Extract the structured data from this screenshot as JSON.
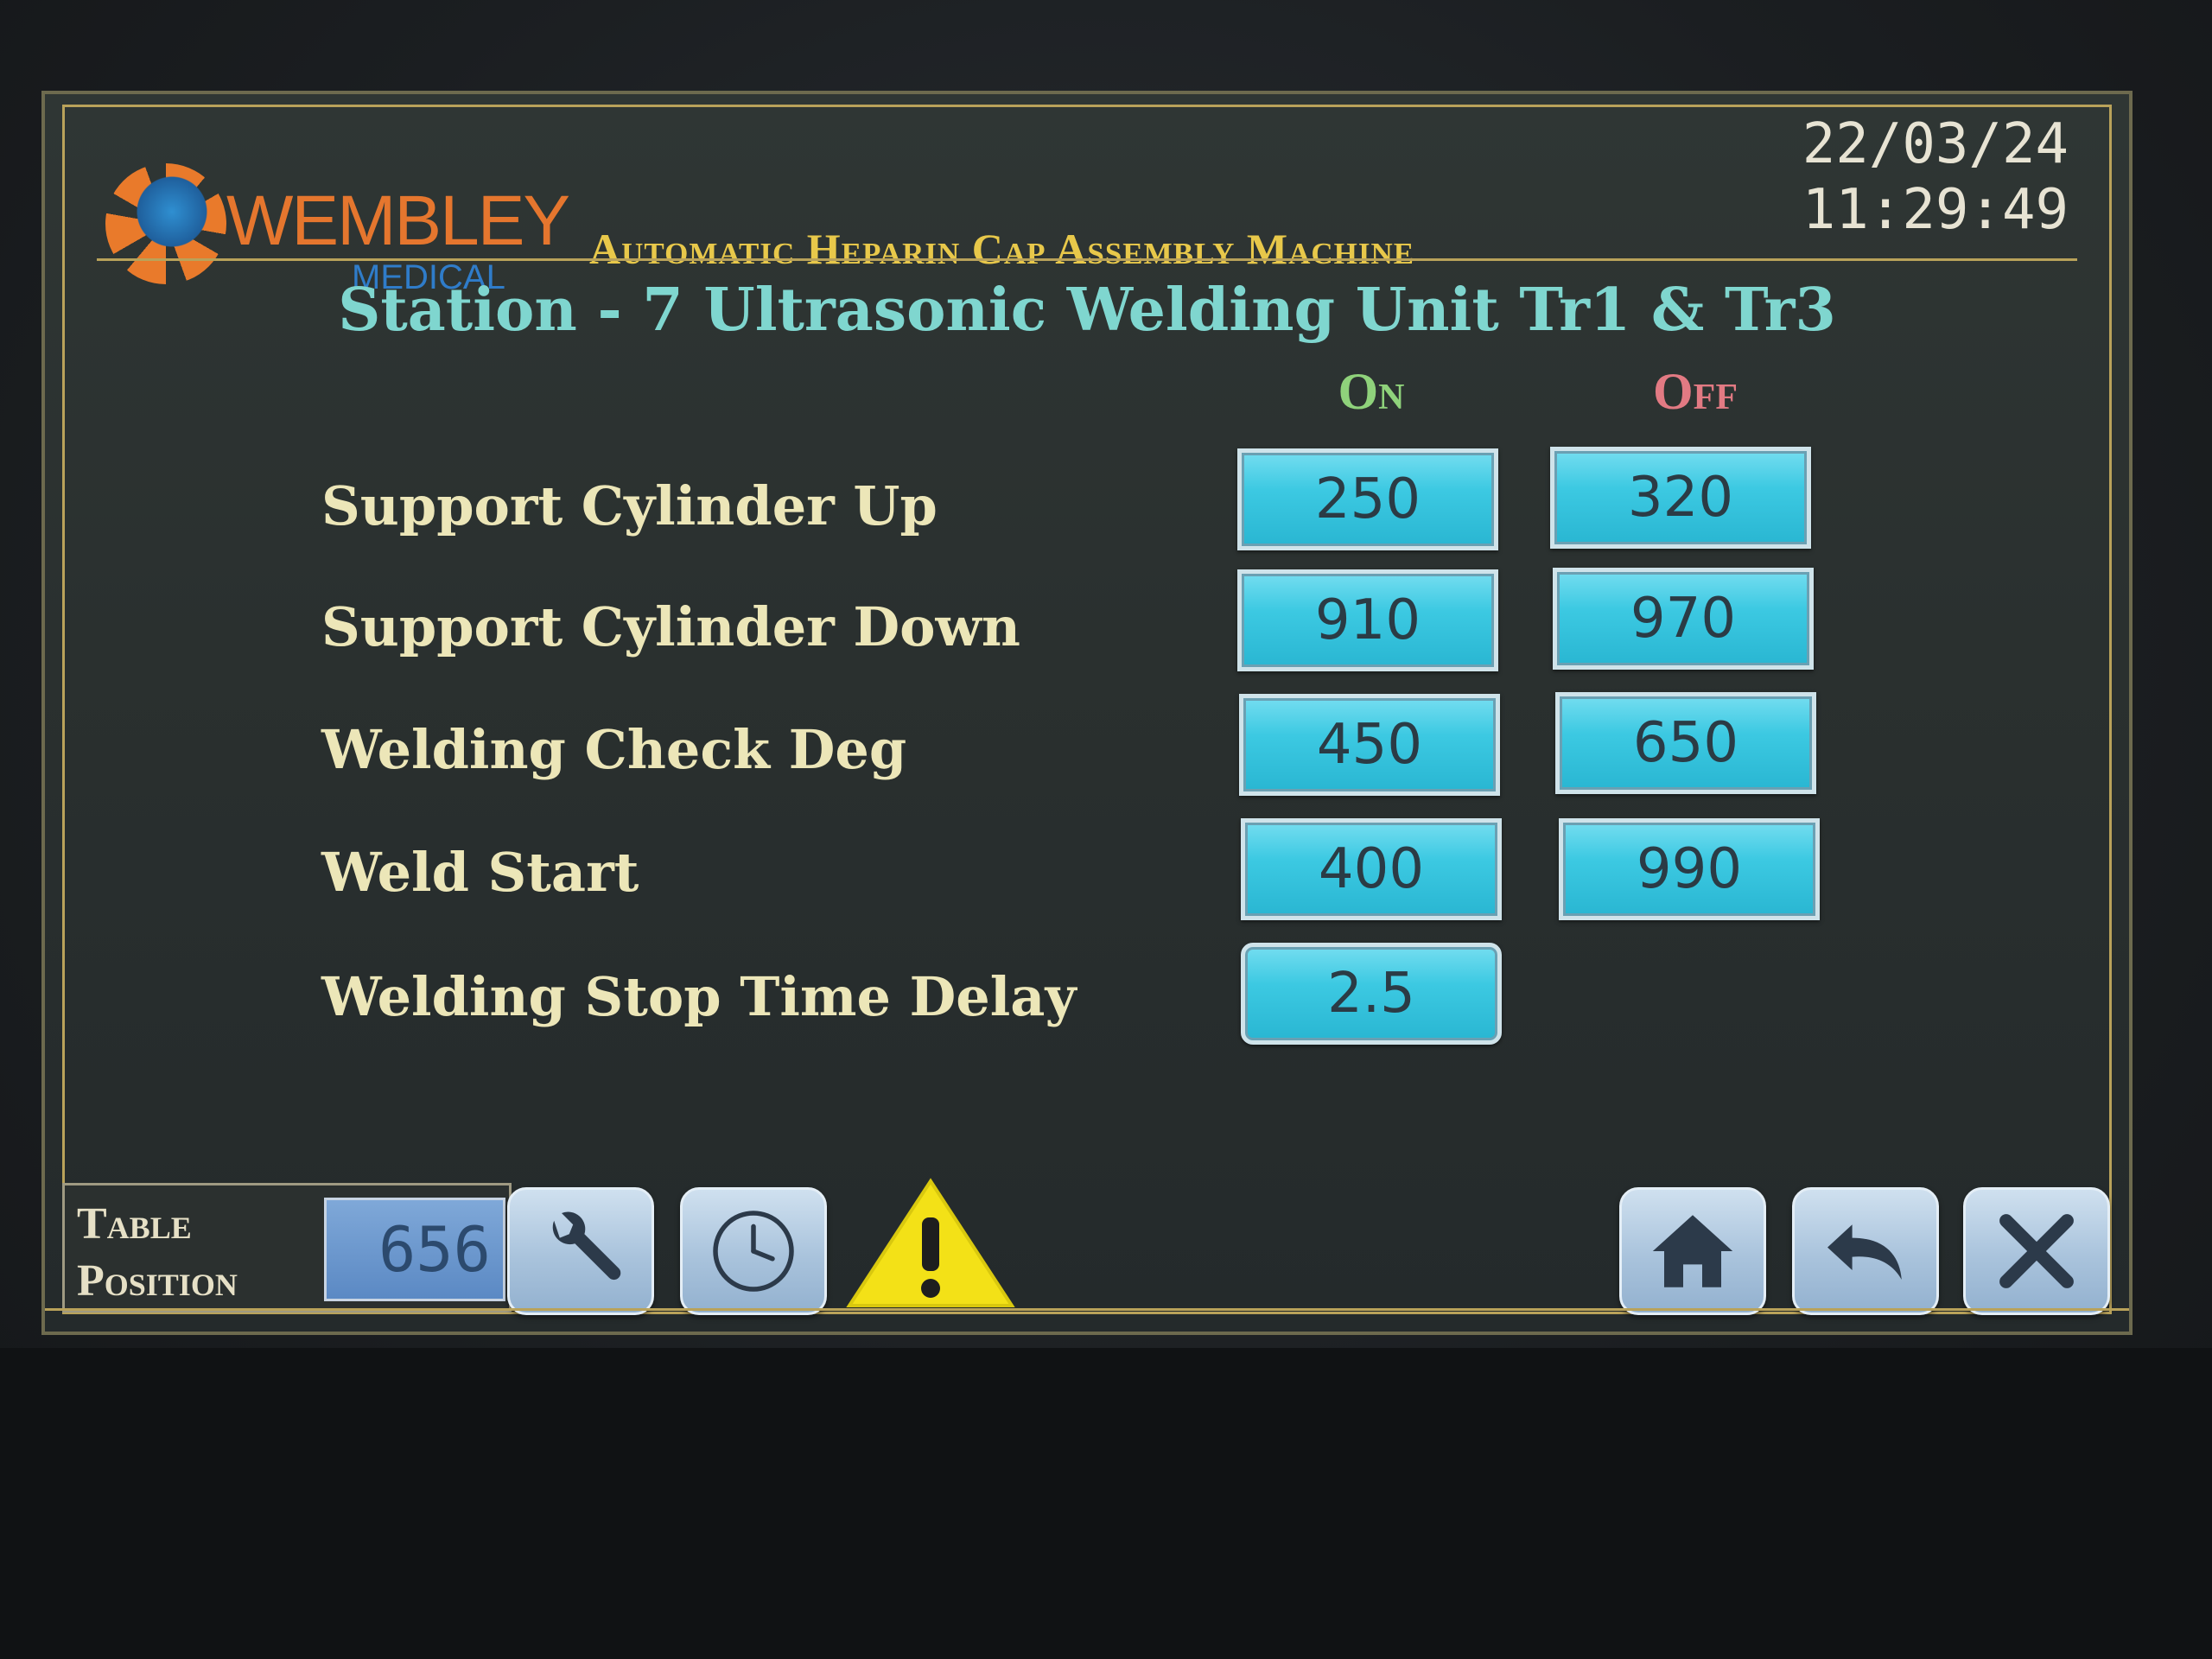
{
  "brand": {
    "name": "WEMBLEY",
    "sub": "MEDICAL"
  },
  "header": {
    "machine_title": "Automatic Heparin Cap Assembly Machine",
    "date": "22/03/24",
    "time": "11:29:49"
  },
  "station_title": "Station - 7 Ultrasonic Welding Unit Tr1 & Tr3",
  "columns": {
    "on": "On",
    "off": "Off"
  },
  "params": [
    {
      "label": "Support Cylinder Up",
      "on": "250",
      "off": "320"
    },
    {
      "label": "Support Cylinder Down",
      "on": "910",
      "off": "970"
    },
    {
      "label": "Welding Check Deg",
      "on": "450",
      "off": "650"
    },
    {
      "label": "Weld Start",
      "on": "400",
      "off": "990"
    },
    {
      "label": "Welding Stop Time Delay",
      "on": "2.5"
    }
  ],
  "footer": {
    "table_position_label": "Table Position",
    "table_position_value": "656"
  },
  "icons": [
    "wrench-icon",
    "clock-icon",
    "warning-icon",
    "home-icon",
    "back-icon",
    "close-icon"
  ],
  "colors": {
    "accent_gold": "#e8c84a",
    "title_teal": "#7fd6cf",
    "on_green": "#8fd27b",
    "off_red": "#e27a83",
    "value_box": "#3cc9e2"
  }
}
